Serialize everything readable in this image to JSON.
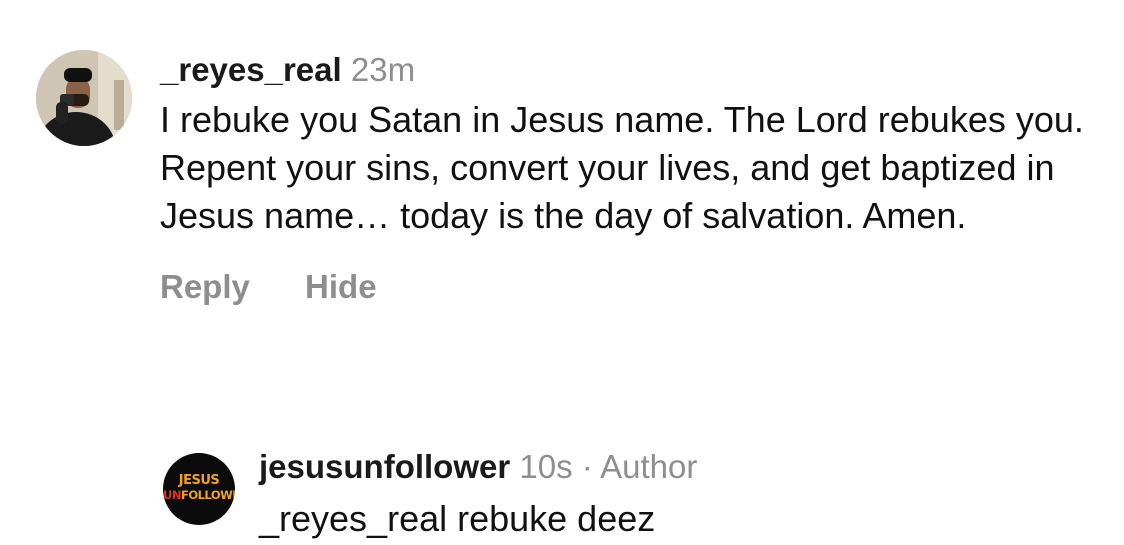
{
  "comments": [
    {
      "username": "_reyes_real",
      "time": "23m",
      "text": "I rebuke you Satan in Jesus name. The Lord rebukes you. Repent your sins, convert your lives, and get baptized in Jesus name… today is the day of salvation. Amen.",
      "actions": {
        "reply": "Reply",
        "hide": "Hide"
      }
    },
    {
      "username": "jesusunfollower",
      "time": "10s",
      "separator": "·",
      "author_badge": "Author",
      "text": "_reyes_real rebuke deez",
      "logo": {
        "line1": "JESUS",
        "line2_red": "UN",
        "line2_rest": "FOLLOWER"
      }
    }
  ],
  "colors": {
    "primary_text": "#111111",
    "secondary_text": "#8e8e8e",
    "logo_orange": "#f2a21a",
    "logo_red": "#e0301e"
  }
}
